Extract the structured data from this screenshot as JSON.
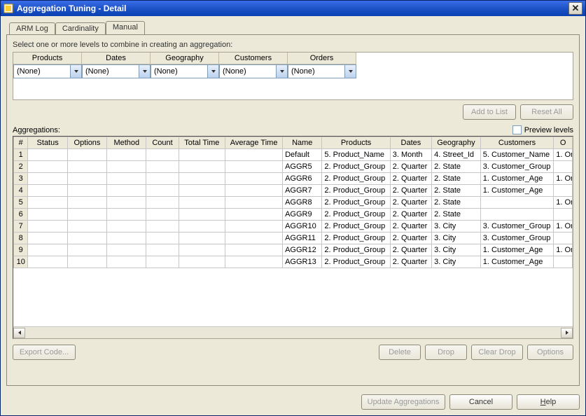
{
  "window": {
    "title": "Aggregation Tuning - Detail"
  },
  "tabs": [
    {
      "label": "ARM Log",
      "active": false
    },
    {
      "label": "Cardinality",
      "active": false
    },
    {
      "label": "Manual",
      "active": true
    }
  ],
  "instruction": "Select one or more levels to combine in creating an aggregation:",
  "levels": {
    "columns": [
      "Products",
      "Dates",
      "Geography",
      "Customers",
      "Orders"
    ],
    "values": [
      "(None)",
      "(None)",
      "(None)",
      "(None)",
      "(None)"
    ]
  },
  "buttons": {
    "add_to_list": "Add to List",
    "reset_all": "Reset All",
    "export_code": "Export Code...",
    "delete": "Delete",
    "drop": "Drop",
    "clear_drop": "Clear Drop",
    "options": "Options",
    "update_agg": "Update Aggregations",
    "cancel": "Cancel",
    "help": "Help"
  },
  "agg_label": "Aggregations:",
  "preview_label": "Preview levels",
  "grid": {
    "headers": [
      "#",
      "Status",
      "Options",
      "Method",
      "Count",
      "Total Time",
      "Average Time",
      "Name",
      "Products",
      "Dates",
      "Geography",
      "Customers",
      "O"
    ],
    "rows": [
      {
        "n": "1",
        "status": "",
        "options": "",
        "method": "",
        "count": "",
        "total": "",
        "avg": "",
        "name": "Default",
        "products": "5. Product_Name",
        "dates": "3. Month",
        "geography": "4. Street_Id",
        "customers": "5. Customer_Name",
        "orders": "1. Or"
      },
      {
        "n": "2",
        "status": "",
        "options": "",
        "method": "",
        "count": "",
        "total": "",
        "avg": "",
        "name": "AGGR5",
        "products": "2. Product_Group",
        "dates": "2. Quarter",
        "geography": "2. State",
        "customers": "3. Customer_Group",
        "orders": ""
      },
      {
        "n": "3",
        "status": "",
        "options": "",
        "method": "",
        "count": "",
        "total": "",
        "avg": "",
        "name": "AGGR6",
        "products": "2. Product_Group",
        "dates": "2. Quarter",
        "geography": "2. State",
        "customers": "1. Customer_Age",
        "orders": "1. Or"
      },
      {
        "n": "4",
        "status": "",
        "options": "",
        "method": "",
        "count": "",
        "total": "",
        "avg": "",
        "name": "AGGR7",
        "products": "2. Product_Group",
        "dates": "2. Quarter",
        "geography": "2. State",
        "customers": "1. Customer_Age",
        "orders": ""
      },
      {
        "n": "5",
        "status": "",
        "options": "",
        "method": "",
        "count": "",
        "total": "",
        "avg": "",
        "name": "AGGR8",
        "products": "2. Product_Group",
        "dates": "2. Quarter",
        "geography": "2. State",
        "customers": "",
        "orders": "1. Or"
      },
      {
        "n": "6",
        "status": "",
        "options": "",
        "method": "",
        "count": "",
        "total": "",
        "avg": "",
        "name": "AGGR9",
        "products": "2. Product_Group",
        "dates": "2. Quarter",
        "geography": "2. State",
        "customers": "",
        "orders": ""
      },
      {
        "n": "7",
        "status": "",
        "options": "",
        "method": "",
        "count": "",
        "total": "",
        "avg": "",
        "name": "AGGR10",
        "products": "2. Product_Group",
        "dates": "2. Quarter",
        "geography": "3. City",
        "customers": "3. Customer_Group",
        "orders": "1. Or"
      },
      {
        "n": "8",
        "status": "",
        "options": "",
        "method": "",
        "count": "",
        "total": "",
        "avg": "",
        "name": "AGGR11",
        "products": "2. Product_Group",
        "dates": "2. Quarter",
        "geography": "3. City",
        "customers": "3. Customer_Group",
        "orders": ""
      },
      {
        "n": "9",
        "status": "",
        "options": "",
        "method": "",
        "count": "",
        "total": "",
        "avg": "",
        "name": "AGGR12",
        "products": "2. Product_Group",
        "dates": "2. Quarter",
        "geography": "3. City",
        "customers": "1. Customer_Age",
        "orders": "1. Or"
      },
      {
        "n": "10",
        "status": "",
        "options": "",
        "method": "",
        "count": "",
        "total": "",
        "avg": "",
        "name": "AGGR13",
        "products": "2. Product_Group",
        "dates": "2. Quarter",
        "geography": "3. City",
        "customers": "1. Customer_Age",
        "orders": ""
      }
    ]
  }
}
